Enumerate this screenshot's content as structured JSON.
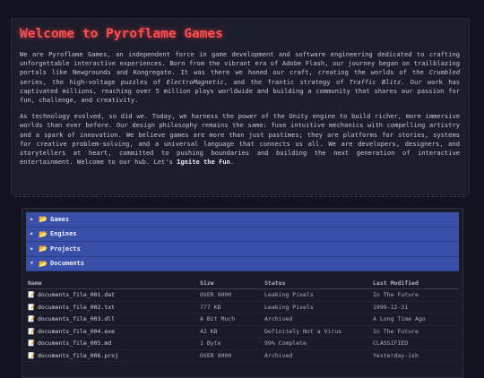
{
  "intro": {
    "title": "Welcome to Pyroflame Games",
    "p1": {
      "a": "We are Pyroflame Games, an independent force in game development and software engineering dedicated to crafting unforgettable interactive experiences. Born from the vibrant era of Adobe Flash, our journey began on trailblazing portals like Newgrounds and Kongregate. It was there we honed our craft, creating the worlds of the ",
      "em1": "Crumbled",
      "b": " series, the high-voltage puzzles of ",
      "em2": "ElectroMagnetic",
      "c": ", and the frantic strategy of ",
      "em3": "Traffic Blitz",
      "d": ". Our work has captivated millions, reaching over 5 million plays worldwide and building a community that shares our passion for fun, challenge, and creativity."
    },
    "p2": {
      "a": "As technology evolved, so did we. Today, we harness the power of the Unity engine to build richer, more immersive worlds than ever before. Our design philosophy remains the same: fuse intuitive mechanics with compelling artistry and a spark of innovation. We believe games are more than just pastimes; they are platforms for stories, systems for creative problem-solving, and a universal language that connects us all. We are developers, designers, and storytellers at heart, committed to pushing boundaries and building the next generation of interactive entertainment. Welcome to our hub. Let's ",
      "strong": "Ignite the Fun",
      "b": "."
    }
  },
  "browser": {
    "folders": [
      {
        "label": "Games",
        "chevron": "▶",
        "icon": "📂"
      },
      {
        "label": "Engines",
        "chevron": "▶",
        "icon": "📂"
      },
      {
        "label": "Projects",
        "chevron": "▶",
        "icon": "📂"
      },
      {
        "label": "Documents",
        "chevron": "▼",
        "icon": "📂"
      }
    ],
    "columns": {
      "name": "Name",
      "size": "Size",
      "status": "Status",
      "modified": "Last Modified"
    },
    "file_icon": "📝",
    "files": [
      {
        "name": "documents_file_001.dat",
        "size": "OVER 9000",
        "status": "Leaking Pixels",
        "modified": "In The Future"
      },
      {
        "name": "documents_file_002.txt",
        "size": "777 KB",
        "status": "Leaking Pixels",
        "modified": "1999-12-31"
      },
      {
        "name": "documents_file_003.dll",
        "size": "A Bit Much",
        "status": "Archived",
        "modified": "A Long Time Ago"
      },
      {
        "name": "documents_file_004.exe",
        "size": "42 KB",
        "status": "Definitely Not a Virus",
        "modified": "In The Future"
      },
      {
        "name": "documents_file_005.md",
        "size": "1 Byte",
        "status": "99% Complete",
        "modified": "CLASSIFIED"
      },
      {
        "name": "documents_file_006.proj",
        "size": "OVER 9000",
        "status": "Archived",
        "modified": "Yesterday-ish"
      }
    ]
  },
  "colors": {
    "title": "#ff4f4f",
    "folder_bar": "#3a4fa8",
    "background": "#13131f"
  }
}
